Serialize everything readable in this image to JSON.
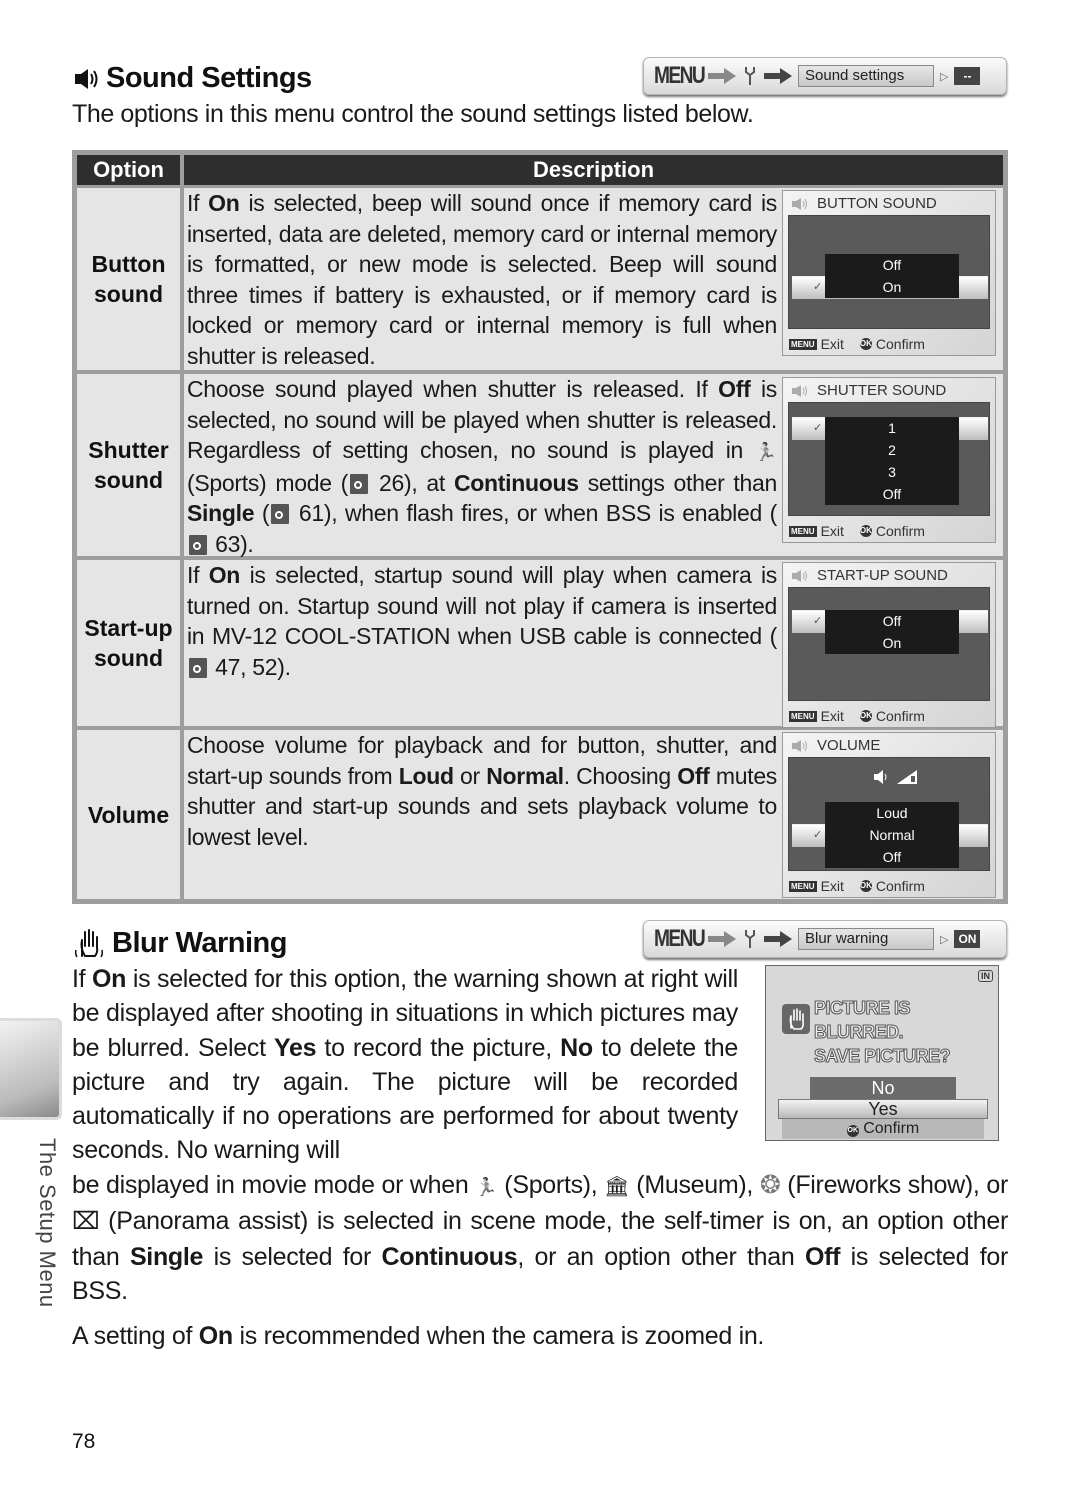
{
  "sound_settings": {
    "title": "Sound Settings",
    "menu_path": {
      "menu": "MENU",
      "field": "Sound settings",
      "value": "--"
    },
    "intro": "The options in this menu control the sound settings listed below.",
    "table": {
      "headers": {
        "option": "Option",
        "description": "Description"
      },
      "rows": [
        {
          "option": "Button sound",
          "description_parts": [
            [
              "If ",
              false
            ],
            [
              "On",
              true
            ],
            [
              " is selected, beep will sound once if memory card is inserted, data are deleted, memory card or internal memory is formatted, or new mode is selected.  Beep will sound three times if battery is exhausted, or if memory card is locked or memory card or internal memory is full when shutter is released.",
              false
            ]
          ],
          "screen": {
            "title": "BUTTON SOUND",
            "options": [
              "Off",
              "On"
            ],
            "selected": "On",
            "exit": "Exit",
            "confirm": "Confirm"
          }
        },
        {
          "option": "Shutter sound",
          "description_parts": [
            [
              "Choose sound played when shutter is released.  If ",
              false
            ],
            [
              "Off",
              true
            ],
            [
              " is selected, no sound will be played when shutter is released.  Regardless of setting chosen, no sound is played in ",
              false
            ],
            [
              "{sports}",
              false
            ],
            [
              " (Sports) mode (",
              false
            ],
            [
              "{ref}",
              false
            ],
            [
              " 26), at ",
              false
            ],
            [
              "Continuous",
              true
            ],
            [
              " settings other than ",
              false
            ],
            [
              "Single",
              true
            ],
            [
              " (",
              false
            ],
            [
              "{ref}",
              false
            ],
            [
              " 61), when flash fires, or when BSS is enabled (",
              false
            ],
            [
              "{ref}",
              false
            ],
            [
              " 63).",
              false
            ]
          ],
          "screen": {
            "title": "SHUTTER SOUND",
            "options": [
              "1",
              "2",
              "3",
              "Off"
            ],
            "selected": "1",
            "exit": "Exit",
            "confirm": "Confirm"
          }
        },
        {
          "option": "Start-up sound",
          "description_parts": [
            [
              "If ",
              false
            ],
            [
              "On",
              true
            ],
            [
              " is selected, startup sound will play when camera is turned on.  Startup sound will not play if camera is inserted in MV-12 COOL-STATION when USB cable is connected (",
              false
            ],
            [
              "{ref}",
              false
            ],
            [
              " 47, 52).",
              false
            ]
          ],
          "screen": {
            "title": "START-UP SOUND",
            "options": [
              "Off",
              "On"
            ],
            "selected": "Off",
            "exit": "Exit",
            "confirm": "Confirm"
          }
        },
        {
          "option": "Volume",
          "description_parts": [
            [
              "Choose volume for playback and for button, shutter, and start-up sounds from ",
              false
            ],
            [
              "Loud",
              true
            ],
            [
              " or ",
              false
            ],
            [
              "Normal",
              true
            ],
            [
              ".  Choosing ",
              false
            ],
            [
              "Off",
              true
            ],
            [
              " mutes shutter and start-up sounds and sets playback volume to lowest level.",
              false
            ]
          ],
          "screen": {
            "title": "VOLUME",
            "options": [
              "Loud",
              "Normal",
              "Off"
            ],
            "selected": "Normal",
            "exit": "Exit",
            "confirm": "Confirm"
          }
        }
      ]
    }
  },
  "blur_warning": {
    "title": "Blur Warning",
    "menu_path": {
      "menu": "MENU",
      "field": "Blur warning",
      "value": "ON"
    },
    "paragraph_parts": [
      [
        "If ",
        false
      ],
      [
        "On",
        true
      ],
      [
        " is selected for this option, the warning shown at right will be displayed after shooting in situations in which pictures may be blurred.  Select ",
        false
      ],
      [
        "Yes",
        true
      ],
      [
        " to record the picture, ",
        false
      ],
      [
        "No",
        true
      ],
      [
        " to delete the picture and try again.  The picture will be recorded automatically if no operations are performed for about twenty seconds.  No warning will",
        false
      ]
    ],
    "paragraph2_parts": [
      [
        "be displayed in movie mode or when ",
        false
      ],
      [
        "{sports}",
        false
      ],
      [
        " (Sports), ",
        false
      ],
      [
        "{museum}",
        false
      ],
      [
        " (Museum), ",
        false
      ],
      [
        "{fireworks}",
        false
      ],
      [
        " (Fireworks show), or ",
        false
      ],
      [
        "{panorama}",
        false
      ],
      [
        " (Panorama assist) is selected in scene mode, the self-timer is on, an option other than ",
        false
      ],
      [
        "Single",
        true
      ],
      [
        " is selected for ",
        false
      ],
      [
        "Continuous",
        true
      ],
      [
        ", or an option other than ",
        false
      ],
      [
        "Off",
        true
      ],
      [
        " is selected for BSS.",
        false
      ]
    ],
    "screen": {
      "badge": "IN",
      "message_line1": "PICTURE IS BLURRED.",
      "message_line2": "SAVE PICTURE?",
      "options": [
        "No",
        "Yes"
      ],
      "selected": "Yes",
      "confirm": "Confirm"
    },
    "recommend_parts": [
      [
        "A setting of ",
        false
      ],
      [
        "On",
        true
      ],
      [
        " is recommended when the camera is zoomed in.",
        false
      ]
    ]
  },
  "side_tab_label": "The Setup Menu",
  "page_number": "78"
}
